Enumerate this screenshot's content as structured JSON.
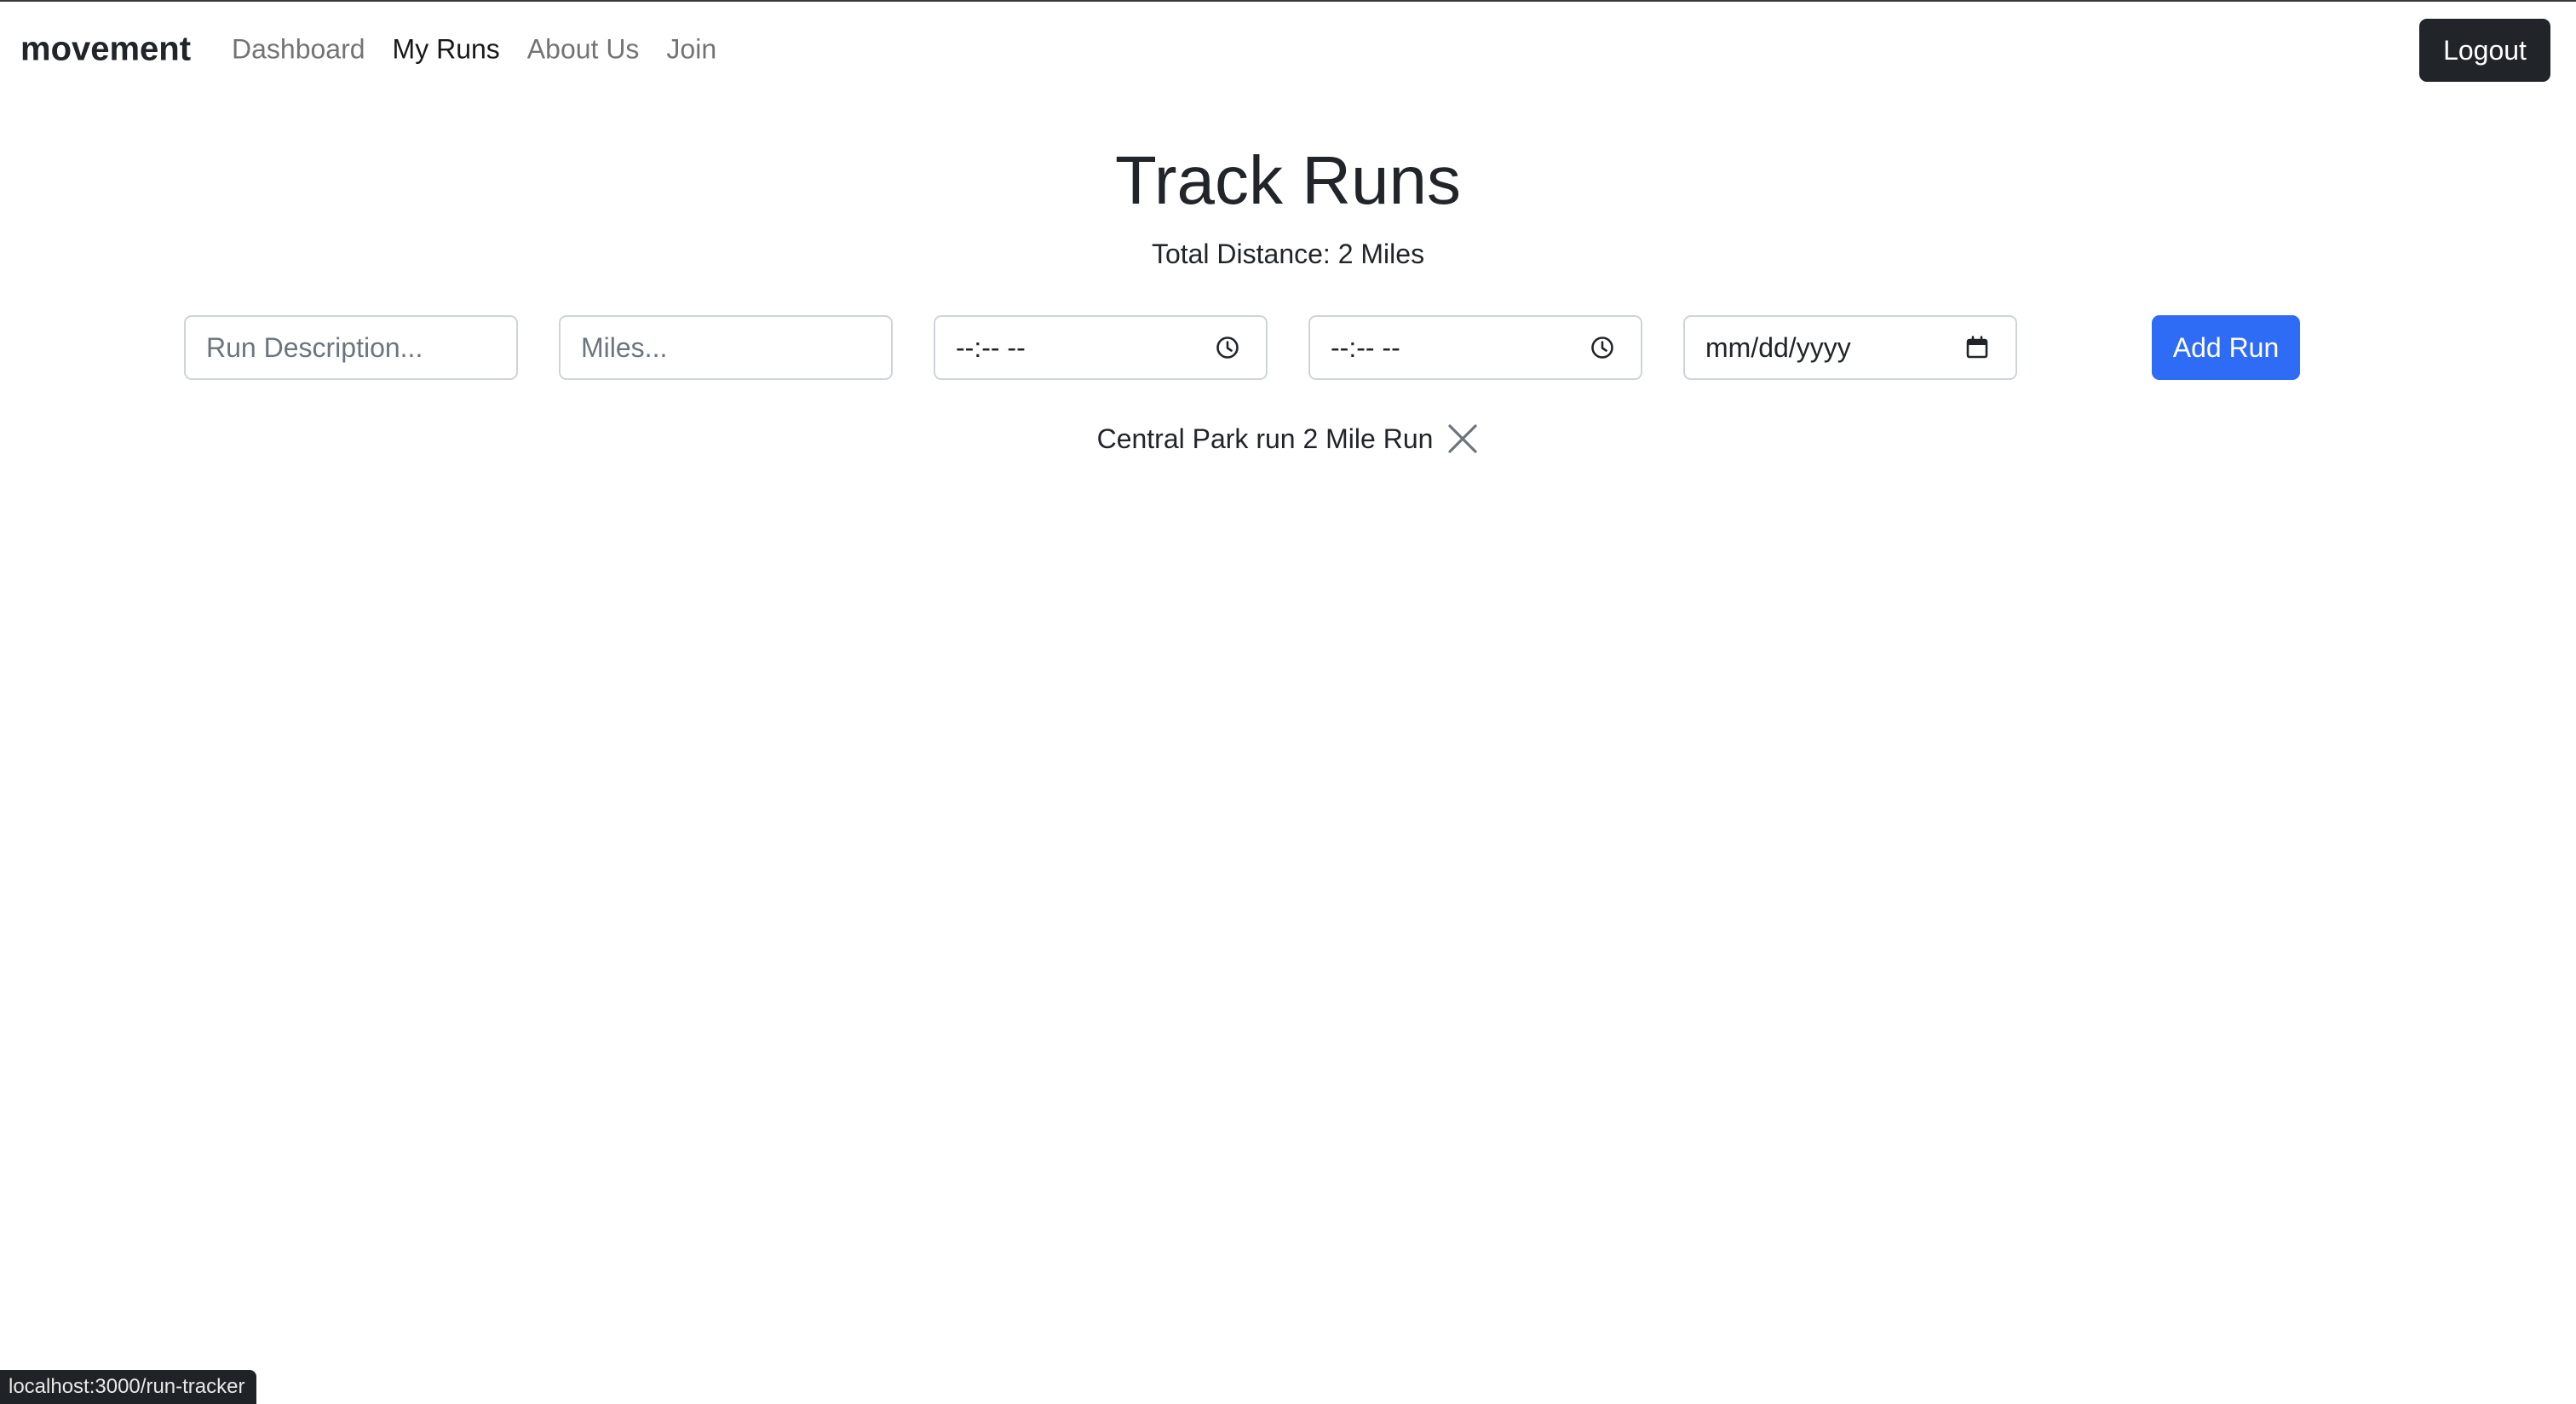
{
  "navbar": {
    "brand": "movement",
    "links": [
      {
        "label": "Dashboard",
        "active": false
      },
      {
        "label": "My Runs",
        "active": true
      },
      {
        "label": "About Us",
        "active": false
      },
      {
        "label": "Join",
        "active": false
      }
    ],
    "logout_label": "Logout"
  },
  "main": {
    "title": "Track Runs",
    "total_distance": "Total Distance: 2 Miles"
  },
  "form": {
    "description_placeholder": "Run Description...",
    "miles_placeholder": "Miles...",
    "start_time_display": "--:-- --",
    "end_time_display": "--:-- --",
    "date_display": "mm/dd/yyyy",
    "add_label": "Add Run",
    "time_icon": "clock-icon",
    "date_icon": "calendar-icon"
  },
  "runs": [
    {
      "text": "Central Park run 2 Mile Run",
      "delete_icon": "close-icon"
    }
  ],
  "status_bar": {
    "url": "localhost:3000/run-tracker"
  },
  "colors": {
    "primary": "#2f6cf5",
    "dark": "#212529",
    "nav_muted": "#8c8c8c"
  }
}
